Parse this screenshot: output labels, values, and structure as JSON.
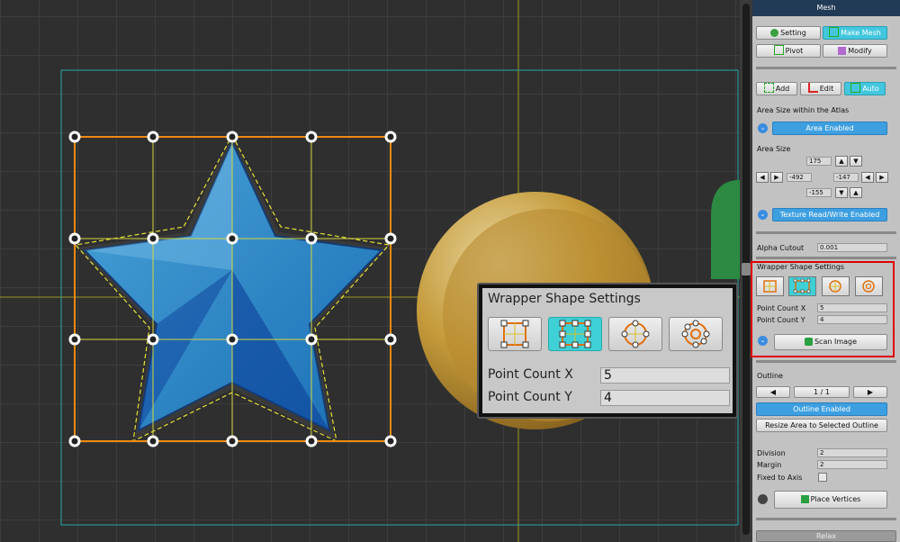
{
  "panel": {
    "title": "Mesh",
    "tabs": {
      "setting": "Setting",
      "make_mesh": "Make Mesh",
      "pivot": "Pivot",
      "modify": "Modify"
    },
    "modes": {
      "add": "Add",
      "edit": "Edit",
      "auto": "Auto"
    },
    "area_atlas_label": "Area Size within the Atlas",
    "area_enabled": "Area Enabled",
    "area_size_label": "Area Size",
    "area_top": "175",
    "area_left": "-492",
    "area_right": "-147",
    "area_bottom": "-155",
    "texture_rw": "Texture Read/Write Enabled",
    "alpha_cutout_label": "Alpha Cutout",
    "alpha_cutout": "0.001",
    "wrapper_label": "Wrapper Shape Settings",
    "point_x_label": "Point Count X",
    "point_x": "5",
    "point_y_label": "Point Count Y",
    "point_y": "4",
    "scan_image": "Scan Image",
    "outline_label": "Outline",
    "outline_page": "1 / 1",
    "outline_enabled": "Outline Enabled",
    "resize_area": "Resize Area to Selected Outline",
    "division_label": "Division",
    "division": "2",
    "margin_label": "Margin",
    "margin": "2",
    "fixed_axis_label": "Fixed to Axis",
    "place_vertices": "Place Vertices",
    "relax": "Relax",
    "arrows": {
      "up": "▲",
      "down": "▼",
      "left": "◀",
      "right": "▶",
      "chevron": "⌄"
    }
  },
  "zoom": {
    "title": "Wrapper Shape Settings",
    "point_x_label": "Point Count X",
    "point_x": "5",
    "point_y_label": "Point Count Y",
    "point_y": "4"
  },
  "colors": {
    "accent_cyan": "#43c7de",
    "enabled_blue": "#3d9fe0",
    "highlight_red": "#e00000",
    "grid_orange": "#f08a10"
  }
}
